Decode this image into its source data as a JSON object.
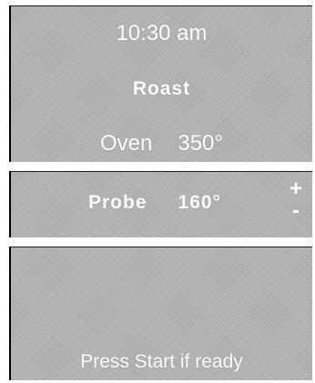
{
  "display": {
    "time": "10:30 am",
    "mode": "Roast",
    "oven_label": "Oven",
    "oven_temp": "350°",
    "probe_label": "Probe",
    "probe_temp": "160°",
    "plus_symbol": "+",
    "minus_symbol": "-",
    "prompt": "Press Start if ready"
  }
}
